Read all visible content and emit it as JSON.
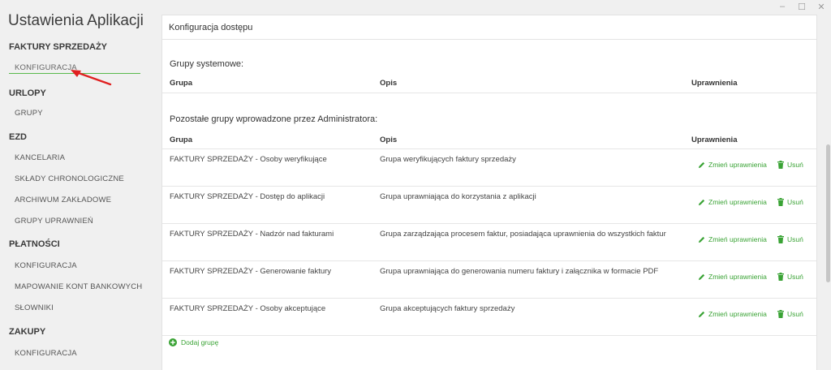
{
  "window": {
    "minimize": "–",
    "maximize": "☐",
    "close": "✕"
  },
  "sidebar": {
    "title": "Ustawienia Aplikacji",
    "sections": [
      {
        "label": "FAKTURY SPRZEDAŻY",
        "items": [
          "KONFIGURACJA"
        ]
      },
      {
        "label": "URLOPY",
        "items": [
          "GRUPY"
        ]
      },
      {
        "label": "EZD",
        "items": [
          "KANCELARIA",
          "SKŁADY CHRONOLOGICZNE",
          "ARCHIWUM ZAKŁADOWE",
          "GRUPY UPRAWNIEŃ"
        ]
      },
      {
        "label": "PŁATNOŚCI",
        "items": [
          "KONFIGURACJA",
          "MAPOWANIE KONT BANKOWYCH",
          "SŁOWNIKI"
        ]
      },
      {
        "label": "ZAKUPY",
        "items": [
          "KONFIGURACJA"
        ]
      }
    ],
    "active_item": "KONFIGURACJA"
  },
  "main": {
    "title": "Konfiguracja dostępu",
    "system_groups": {
      "title": "Grupy systemowe:",
      "columns": [
        "Grupa",
        "Opis",
        "Uprawnienia"
      ]
    },
    "other_groups": {
      "title": "Pozostałe grupy wprowadzone przez Administratora:",
      "columns": [
        "Grupa",
        "Opis",
        "Uprawnienia"
      ],
      "rows": [
        {
          "group": "FAKTURY SPRZEDAŻY - Osoby weryfikujące",
          "description": "Grupa weryfikujących faktury sprzedaży"
        },
        {
          "group": "FAKTURY SPRZEDAŻY - Dostęp do aplikacji",
          "description": "Grupa uprawniająca do korzystania z aplikacji"
        },
        {
          "group": "FAKTURY SPRZEDAŻY - Nadzór nad fakturami",
          "description": "Grupa zarządzająca procesem faktur, posiadająca uprawnienia do wszystkich faktur"
        },
        {
          "group": "FAKTURY SPRZEDAŻY - Generowanie faktury",
          "description": "Grupa uprawniająca do generowania numeru faktury i załącznika w formacie PDF"
        },
        {
          "group": "FAKTURY SPRZEDAŻY - Osoby akceptujące",
          "description": "Grupa akceptujących faktury sprzedaży"
        }
      ],
      "change_label": "Zmień uprawnienia",
      "delete_label": "Usuń"
    },
    "add_group_label": "Dodaj grupę"
  },
  "colors": {
    "accent": "#3aa335",
    "annotation_arrow": "#e02020"
  }
}
